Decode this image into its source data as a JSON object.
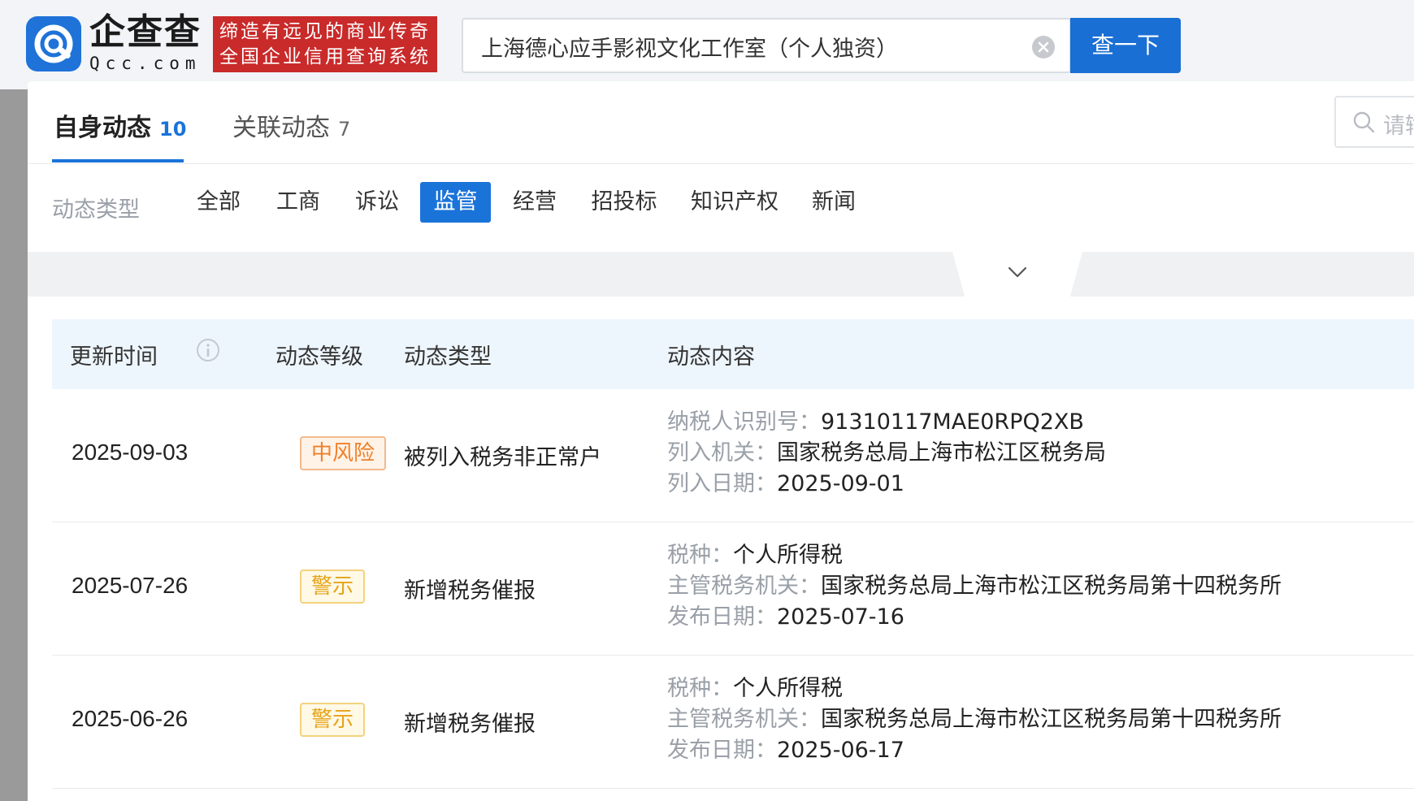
{
  "header": {
    "logo_cn": "企查查",
    "logo_en": "Qcc.com",
    "slogan_line1": "缔造有远见的商业传奇",
    "slogan_line2": "全国企业信用查询系统",
    "search_value": "上海德心应手影视文化工作室（个人独资）",
    "search_button": "查一下"
  },
  "tabs": [
    {
      "label": "自身动态",
      "count": "10"
    },
    {
      "label": "关联动态",
      "count": "7"
    }
  ],
  "panel_search_placeholder": "请输",
  "filter": {
    "label": "动态类型",
    "options": [
      "全部",
      "工商",
      "诉讼",
      "监管",
      "经营",
      "招投标",
      "知识产权",
      "新闻"
    ],
    "active": "监管"
  },
  "table": {
    "headers": [
      "更新时间",
      "动态等级",
      "动态类型",
      "动态内容"
    ],
    "rows": [
      {
        "date": "2025-09-03",
        "level": "中风险",
        "type": "被列入税务非正常户",
        "content": [
          {
            "k": "纳税人识别号：",
            "v": "91310117MAE0RPQ2XB"
          },
          {
            "k": "列入机关：",
            "v": "国家税务总局上海市松江区税务局"
          },
          {
            "k": "列入日期：",
            "v": "2025-09-01"
          }
        ]
      },
      {
        "date": "2025-07-26",
        "level": "警示",
        "type": "新增税务催报",
        "content": [
          {
            "k": "税种：",
            "v": "个人所得税"
          },
          {
            "k": "主管税务机关：",
            "v": "国家税务总局上海市松江区税务局第十四税务所"
          },
          {
            "k": "发布日期：",
            "v": "2025-07-16"
          }
        ]
      },
      {
        "date": "2025-06-26",
        "level": "警示",
        "type": "新增税务催报",
        "content": [
          {
            "k": "税种：",
            "v": "个人所得税"
          },
          {
            "k": "主管税务机关：",
            "v": "国家税务总局上海市松江区税务局第十四税务所"
          },
          {
            "k": "发布日期：",
            "v": "2025-06-17"
          }
        ]
      }
    ]
  },
  "colors": {
    "brand_blue": "#1a73d9",
    "slogan_red": "#c92a2a",
    "mid_risk": "#f0802a",
    "warning": "#e6a317"
  }
}
